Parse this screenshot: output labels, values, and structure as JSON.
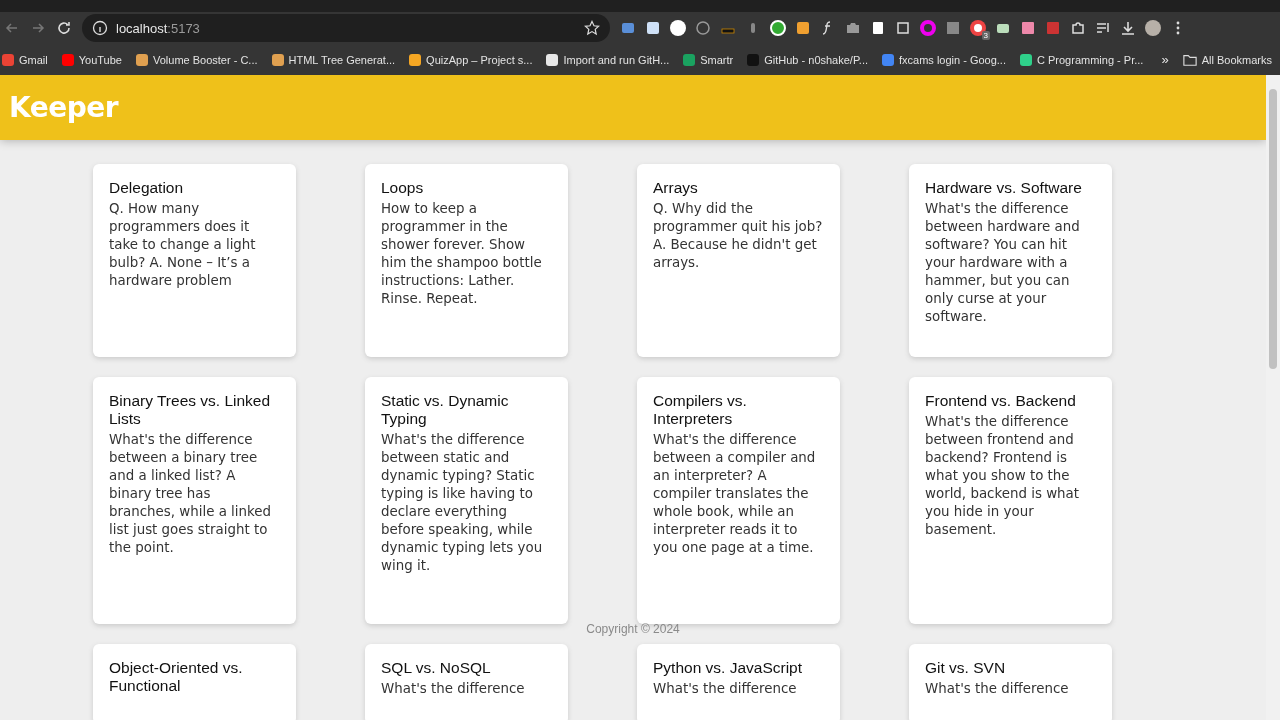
{
  "browser": {
    "address": "localhost",
    "port": ":5173",
    "extension_badge": "3",
    "bookmarks": [
      {
        "label": "Gmail",
        "color": "#ea4335"
      },
      {
        "label": "YouTube",
        "color": "#ff0000"
      },
      {
        "label": "Volume Booster - C...",
        "color": "#e0a050"
      },
      {
        "label": "HTML Tree Generat...",
        "color": "#e0a050"
      },
      {
        "label": "QuizApp – Project s...",
        "color": "#f5a623"
      },
      {
        "label": "Import and run GitH...",
        "color": "#e8e8e8"
      },
      {
        "label": "Smartr",
        "color": "#1aa260"
      },
      {
        "label": "GitHub - n0shake/P...",
        "color": "#111111"
      },
      {
        "label": "fxcams login - Goog...",
        "color": "#4285f4"
      },
      {
        "label": "C Programming - Pr...",
        "color": "#2fd08a"
      }
    ],
    "more": "»",
    "all_bookmarks": "All Bookmarks"
  },
  "app": {
    "title": "Keeper",
    "notes": [
      {
        "title": "Delegation",
        "content": "Q. How many programmers does it take to change a light bulb? A. None – It’s a hardware problem"
      },
      {
        "title": "Loops",
        "content": "How to keep a programmer in the shower forever. Show him the shampoo bottle instructions: Lather. Rinse. Repeat."
      },
      {
        "title": "Arrays",
        "content": "Q. Why did the programmer quit his job? A. Because he didn't get arrays."
      },
      {
        "title": "Hardware vs. Software",
        "content": "What's the difference between hardware and software? You can hit your hardware with a hammer, but you can only curse at your software."
      },
      {
        "title": "Binary Trees vs. Linked Lists",
        "content": "What's the difference between a binary tree and a linked list? A binary tree has branches, while a linked list just goes straight to the point."
      },
      {
        "title": "Static vs. Dynamic Typing",
        "content": "What's the difference between static and dynamic typing? Static typing is like having to declare everything before speaking, while dynamic typing lets you wing it."
      },
      {
        "title": "Compilers vs. Interpreters",
        "content": "What's the difference between a compiler and an interpreter? A compiler translates the whole book, while an interpreter reads it to you one page at a time."
      },
      {
        "title": "Frontend vs. Backend",
        "content": "What's the difference between frontend and backend? Frontend is what you show to the world, backend is what you hide in your basement."
      },
      {
        "title": "Object-Oriented vs. Functional"
      },
      {
        "title": "SQL vs. NoSQL",
        "content": "What's the difference"
      },
      {
        "title": "Python vs. JavaScript",
        "content": "What's the difference"
      },
      {
        "title": "Git vs. SVN",
        "content": "What's the difference"
      }
    ],
    "footer": "Copyright © 2024"
  }
}
